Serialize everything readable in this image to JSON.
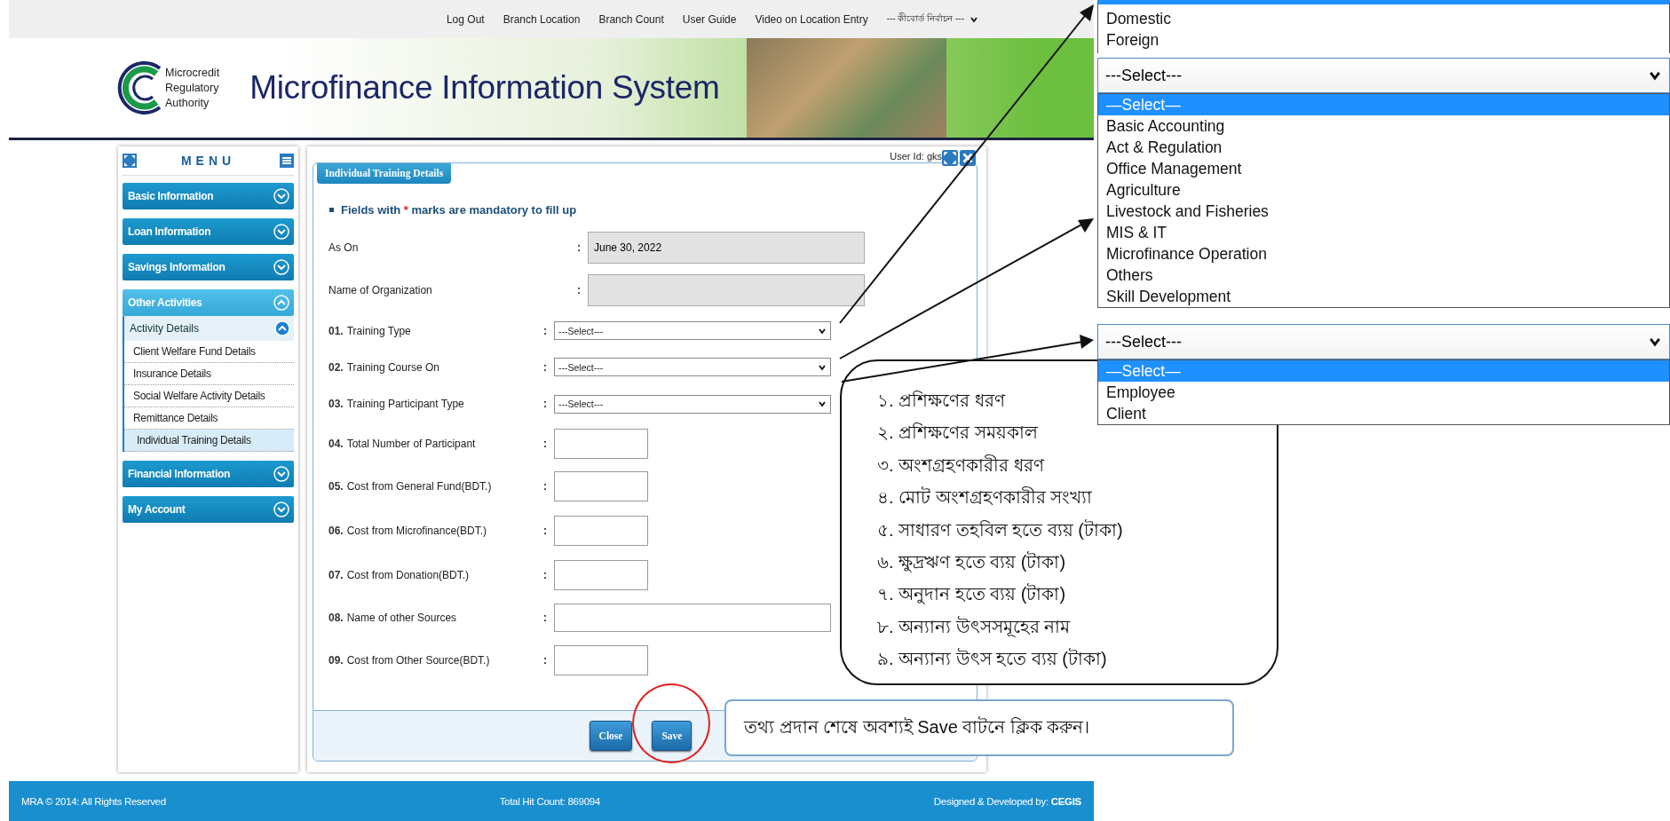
{
  "top_nav": {
    "links": [
      "Log Out",
      "Branch Location",
      "Branch Count",
      "User Guide",
      "Video on Location Entry"
    ],
    "keyboard_select": "--- কীবোর্ড নির্বাচন ---"
  },
  "header": {
    "logo_lines": [
      "Microcredit",
      "Regulatory",
      "Authority"
    ],
    "title": "Microfinance Information System"
  },
  "menu": {
    "title": "MENU",
    "items": [
      {
        "label": "Basic Information",
        "expanded": false
      },
      {
        "label": "Loan Information",
        "expanded": false
      },
      {
        "label": "Savings Information",
        "expanded": false
      },
      {
        "label": "Other Activities",
        "expanded": true,
        "children": [
          {
            "label": "Activity Details",
            "expanded": true,
            "children": [
              {
                "label": "Client Welfare Fund Details",
                "selected": false
              },
              {
                "label": "Insurance Details",
                "selected": false
              },
              {
                "label": "Social Welfare Activity Details",
                "selected": false
              },
              {
                "label": "Remittance Details",
                "selected": false
              },
              {
                "label": "Individual Training Details",
                "selected": true
              }
            ]
          }
        ]
      },
      {
        "label": "Financial Information",
        "expanded": false
      },
      {
        "label": "My Account",
        "expanded": false
      }
    ]
  },
  "form": {
    "title": "Individual Training Details",
    "user_id": "User Id: gks",
    "note": {
      "before": "Fields with",
      "mark": "*",
      "after": "marks are mandatory to fill up"
    },
    "fields": [
      {
        "kind": "readonly",
        "label": "As On",
        "colon": ":",
        "value": "June 30, 2022"
      },
      {
        "kind": "readonly",
        "label": "Name of Organization",
        "colon": ":"
      },
      {
        "kind": "select",
        "number": "01.",
        "label": "Training Type",
        "colon": ":",
        "value": "---Select---"
      },
      {
        "kind": "select",
        "number": "02.",
        "label": "Training Course On",
        "colon": ":",
        "value": "---Select---"
      },
      {
        "kind": "select",
        "number": "03.",
        "label": "Training Participant Type",
        "colon": ":",
        "value": "---Select---"
      },
      {
        "kind": "short",
        "number": "04.",
        "label": "Total Number of Participant",
        "colon": ":"
      },
      {
        "kind": "short",
        "number": "05.",
        "label": "Cost from General Fund(BDT.)",
        "colon": ":"
      },
      {
        "kind": "short",
        "number": "06.",
        "label": "Cost from Microfinance(BDT.)",
        "colon": ":"
      },
      {
        "kind": "short",
        "number": "07.",
        "label": "Cost from Donation(BDT.)",
        "colon": ":"
      },
      {
        "kind": "long",
        "number": "08.",
        "label": "Name of other Sources",
        "colon": ":"
      },
      {
        "kind": "short",
        "number": "09.",
        "label": "Cost from Other Source(BDT.)",
        "colon": ":"
      }
    ],
    "buttons": [
      "Close",
      "Save"
    ]
  },
  "footer": {
    "copyright": "MRA © 2014: All Rights Reserved",
    "hit_count": "Total Hit Count: 869094",
    "credit": "Designed & Developed by: **CEGIS**"
  },
  "annotations": {
    "dropdowns": [
      {
        "options": [
          {
            "label": "Domestic",
            "selected": false
          },
          {
            "label": "Foreign",
            "selected": false
          }
        ]
      },
      {
        "value": "---Select---",
        "options": [
          {
            "label": "—Select—",
            "selected": true
          },
          {
            "label": "Basic Accounting",
            "selected": false
          },
          {
            "label": "Act & Regulation",
            "selected": false
          },
          {
            "label": "Office Management",
            "selected": false
          },
          {
            "label": "Agriculture",
            "selected": false
          },
          {
            "label": "Livestock and Fisheries",
            "selected": false
          },
          {
            "label": "MIS & IT",
            "selected": false
          },
          {
            "label": "Microfinance Operation",
            "selected": false
          },
          {
            "label": "Others",
            "selected": false
          },
          {
            "label": "Skill Development",
            "selected": false
          }
        ]
      },
      {
        "value": "---Select---",
        "options": [
          {
            "label": "—Select—",
            "selected": true
          },
          {
            "label": "Employee",
            "selected": false
          },
          {
            "label": "Client",
            "selected": false
          }
        ]
      }
    ],
    "legend": [
      "১. প্রশিক্ষণের ধরণ",
      "২. প্রশিক্ষণের সময়কাল",
      "৩. অংশগ্রহণকারীর ধরণ",
      "৪. মোট অংশগ্রহণকারীর সংখ্যা",
      "৫. সাধারণ তহবিল হতে ব্যয় (টাকা)",
      "৬. ক্ষুদ্রঋণ হতে ব্যয় (টাকা)",
      "৭. অনুদান হতে ব্যয় (টাকা)",
      "৮. অন্যান্য উৎসসমূহের নাম",
      "৯. অন্যান্য উৎস হতে ব্যয় (টাকা)"
    ],
    "save_note": "তথ্য প্রদান শেষে অবশ্যই Save বাটনে ক্লিক করুন।"
  }
}
